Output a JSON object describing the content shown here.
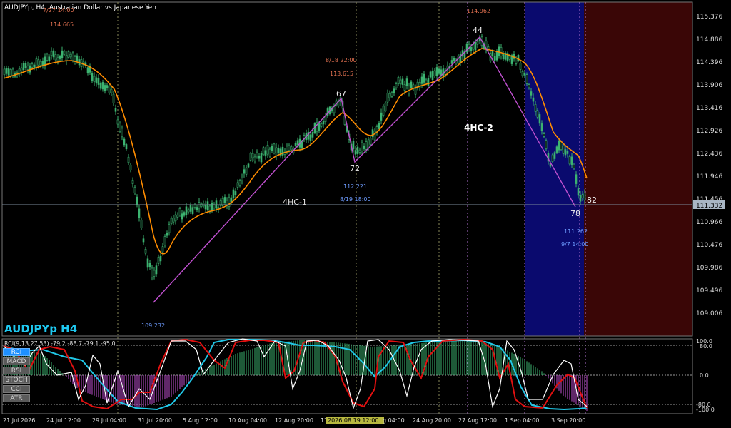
{
  "window": {
    "title": "AUDJPYp, H4:  Australian Dollar vs Japanese Yen",
    "symbol_label": "AUDJPYp H4"
  },
  "colors": {
    "background": "#000000",
    "bull": "#3cb371",
    "ma": "#ff8c00",
    "wave": "#c050d0",
    "zone_blue": "#0a0a6e",
    "zone_red": "#3a0606",
    "label_red": "#e07050",
    "label_blue": "#6e9cff",
    "rci_fast": "#ffffff",
    "rci_mid": "#e01010",
    "rci_slow": "#20c8e8",
    "hist_pos": "#3cb371",
    "hist_neg": "#c050d0",
    "symbol_label": "#1ec8f0"
  },
  "price_axis": {
    "ticks": [
      "115.376",
      "114.886",
      "114.396",
      "113.906",
      "113.416",
      "112.926",
      "112.436",
      "111.946",
      "111.456",
      "110.966",
      "110.476",
      "109.986",
      "109.496",
      "109.006"
    ],
    "current_price": "111.332"
  },
  "time_axis": {
    "ticks": [
      "21 Jul 2026",
      "24 Jul 12:00",
      "29 Jul 04:00",
      "31 Jul 20:00",
      "5 Aug 12:00",
      "10 Aug 04:00",
      "12 Aug 20:00",
      "17",
      "g 04:00",
      "24 Aug 20:00",
      "27 Aug 12:00",
      "1 Sep 04:00",
      "3 Sep 20:00"
    ],
    "highlight": "2026.08.19 12:00"
  },
  "annotations": {
    "h1_date": "7/27 14:00",
    "h1_price": "114.665",
    "top_price": "114.962",
    "mid_date": "8/18 22:00",
    "mid_price": "113.615",
    "low_price": "109.232",
    "l2_price": "112.221",
    "l2_date": "8/19 18:00",
    "l3_price": "111.262",
    "l3_date": "9/7 14:00",
    "wave_label_1": "4HC-1",
    "wave_label_2": "4HC-2",
    "pt_67": "67",
    "pt_72": "72",
    "pt_44": "44",
    "pt_78": "78",
    "pt_82": "82"
  },
  "indicator": {
    "header": "RCI(9,13,27,53) -79.2 -88.7 -79.1 -95.0",
    "levels": [
      "100.0",
      "80.0",
      "0.0",
      "-80.0",
      "-100.0"
    ],
    "buttons": [
      {
        "label": "RCI",
        "active": true
      },
      {
        "label": "MACD",
        "active": false
      },
      {
        "label": "RSI",
        "active": false
      },
      {
        "label": "STOCH",
        "active": false
      },
      {
        "label": "CCI",
        "active": false
      },
      {
        "label": "ATR",
        "active": false
      }
    ]
  }
}
